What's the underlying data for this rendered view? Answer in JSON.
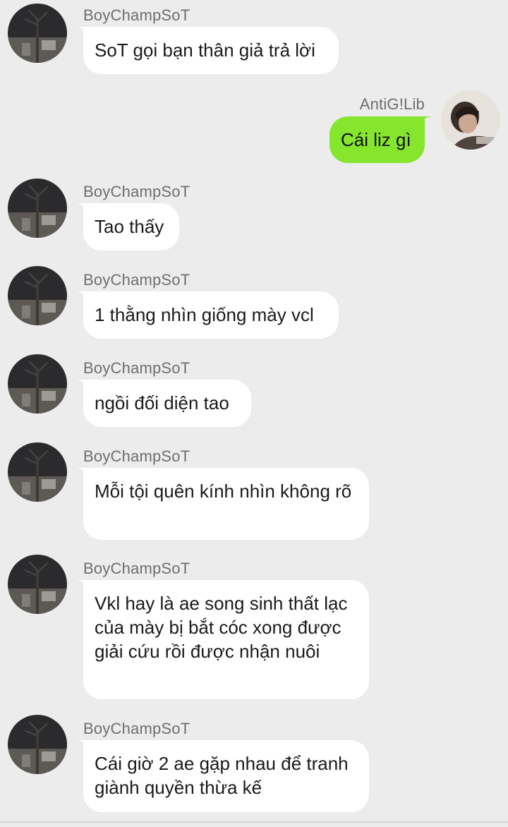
{
  "colors": {
    "background": "#ececec",
    "incoming_bubble": "#ffffff",
    "outgoing_bubble": "#86e62e",
    "name_text": "#6f6f6f"
  },
  "messages": [
    {
      "sender": "BoyChampSoT",
      "text": "SoT gọi bạn thân giả trả lời"
    },
    {
      "sender": "AntiG!Lib",
      "text": "Cái liz gì"
    },
    {
      "sender": "BoyChampSoT",
      "text": "Tao thấy"
    },
    {
      "sender": "BoyChampSoT",
      "text": "1 thằng nhìn giống mày vcl"
    },
    {
      "sender": "BoyChampSoT",
      "text": "ngồi đối diện tao"
    },
    {
      "sender": "BoyChampSoT",
      "text": "Mỗi tội quên kính nhìn không rõ"
    },
    {
      "sender": "BoyChampSoT",
      "text": "Vkl hay là ae song sinh thất lạc của mày bị bắt cóc xong được giải cứu rồi được nhận nuôi"
    },
    {
      "sender": "BoyChampSoT",
      "text": "Cái giờ 2 ae gặp nhau để tranh giành quyền thừa kế"
    }
  ]
}
